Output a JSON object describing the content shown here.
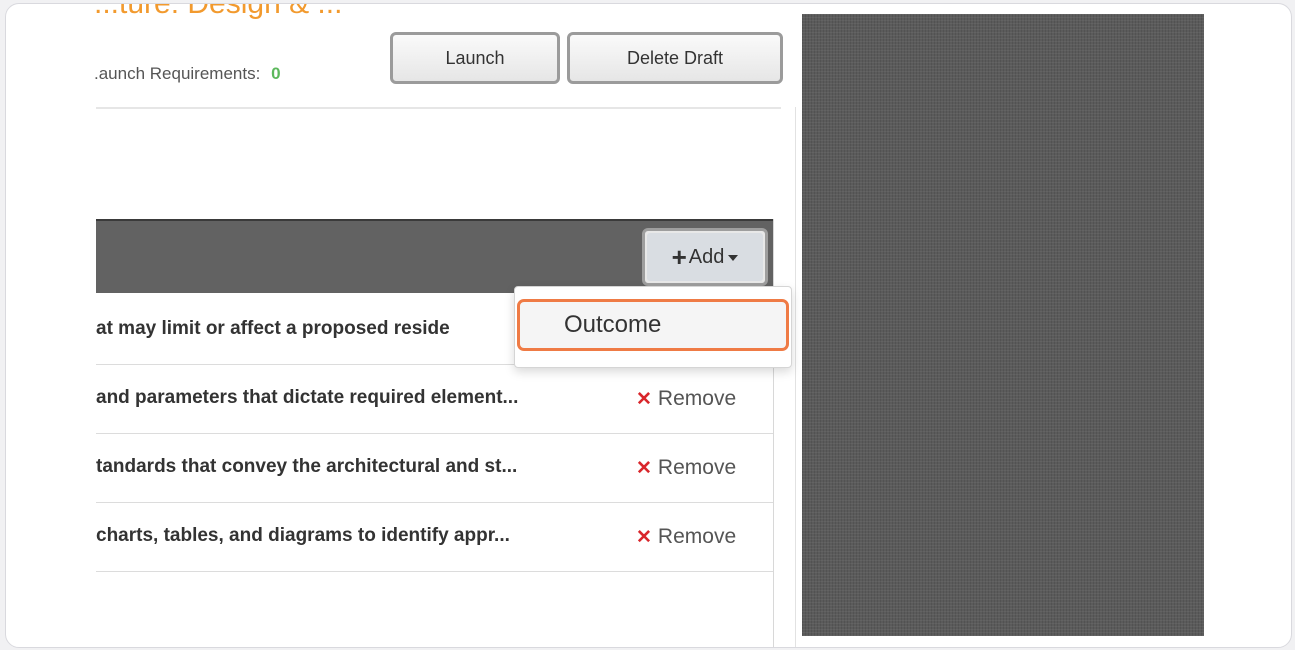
{
  "header": {
    "title": "...ture: Design & ...",
    "requirements_label": ".aunch Requirements:",
    "requirements_count": "0",
    "launch_label": "Launch",
    "delete_label": "Delete Draft"
  },
  "toolbar": {
    "add_label": "Add"
  },
  "dropdown": {
    "items": [
      {
        "label": "Outcome"
      }
    ]
  },
  "rows": [
    {
      "text": "at may limit or affect a proposed reside",
      "action": ""
    },
    {
      "text": "and parameters that dictate required element...",
      "action": "Remove"
    },
    {
      "text": "tandards that convey the architectural and st...",
      "action": "Remove"
    },
    {
      "text": "charts, tables, and diagrams to identify appr...",
      "action": "Remove"
    }
  ],
  "colors": {
    "title": "#f29a2e",
    "count": "#5cb85c",
    "remove_x": "#d9262b",
    "highlight": "#ef7b45",
    "bar": "#626262"
  }
}
